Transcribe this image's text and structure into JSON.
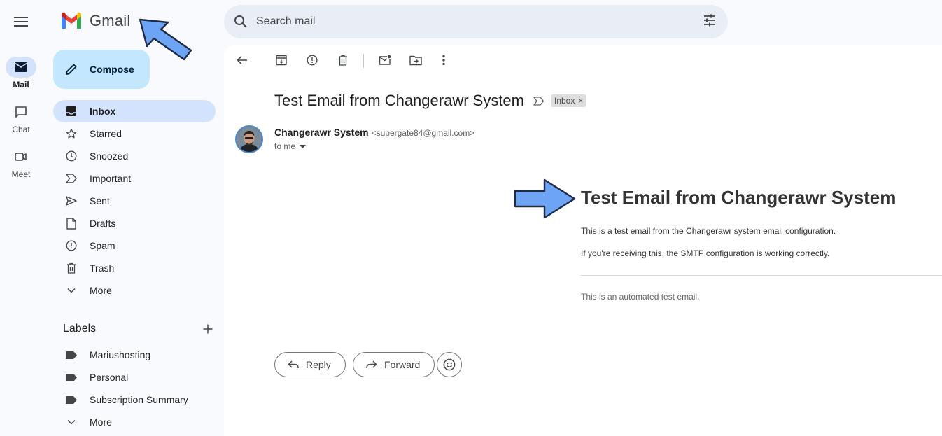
{
  "app": {
    "logo_text": "Gmail",
    "menu_icon": "hamburger-icon"
  },
  "rail": [
    {
      "label": "Mail",
      "icon": "mail-icon",
      "active": true
    },
    {
      "label": "Chat",
      "icon": "chat-icon",
      "active": false
    },
    {
      "label": "Meet",
      "icon": "meet-icon",
      "active": false
    }
  ],
  "compose": {
    "label": "Compose",
    "icon": "pencil-icon"
  },
  "nav": [
    {
      "label": "Inbox",
      "icon": "inbox-icon",
      "active": true
    },
    {
      "label": "Starred",
      "icon": "star-icon"
    },
    {
      "label": "Snoozed",
      "icon": "clock-icon"
    },
    {
      "label": "Important",
      "icon": "important-icon"
    },
    {
      "label": "Sent",
      "icon": "send-icon"
    },
    {
      "label": "Drafts",
      "icon": "draft-icon"
    },
    {
      "label": "Spam",
      "icon": "spam-icon"
    },
    {
      "label": "Trash",
      "icon": "trash-icon"
    },
    {
      "label": "More",
      "icon": "chevron-down-icon"
    }
  ],
  "labels": {
    "title": "Labels",
    "add_icon": "plus-icon",
    "items": [
      {
        "label": "Mariushosting",
        "icon": "label-icon"
      },
      {
        "label": "Personal",
        "icon": "label-icon"
      },
      {
        "label": "Subscription Summary",
        "icon": "label-icon"
      },
      {
        "label": "More",
        "icon": "chevron-down-icon"
      }
    ]
  },
  "search": {
    "placeholder": "Search mail",
    "icon": "search-icon",
    "filter_icon": "tune-icon"
  },
  "toolbar": [
    "back-icon",
    "archive-icon",
    "report-spam-icon",
    "delete-icon",
    "mark-unread-icon",
    "move-to-icon",
    "more-vert-icon"
  ],
  "email": {
    "subject": "Test Email from Changerawr System",
    "chip": "Inbox",
    "chip_close": "×",
    "sender_name": "Changerawr System",
    "sender_email": "<supergate84@gmail.com>",
    "recipient": "to me",
    "body_heading": "Test Email from Changerawr System",
    "body_p1": "This is a test email from the Changerawr system email configuration.",
    "body_p2": "If you're receiving this, the SMTP configuration is working correctly.",
    "body_footer": "This is an automated test email."
  },
  "actions": {
    "reply": "Reply",
    "forward": "Forward",
    "emoji_icon": "emoji-icon"
  },
  "colors": {
    "accent": "#d3e3fd",
    "compose": "#c2e7ff",
    "callout": "#6ea4f4"
  }
}
